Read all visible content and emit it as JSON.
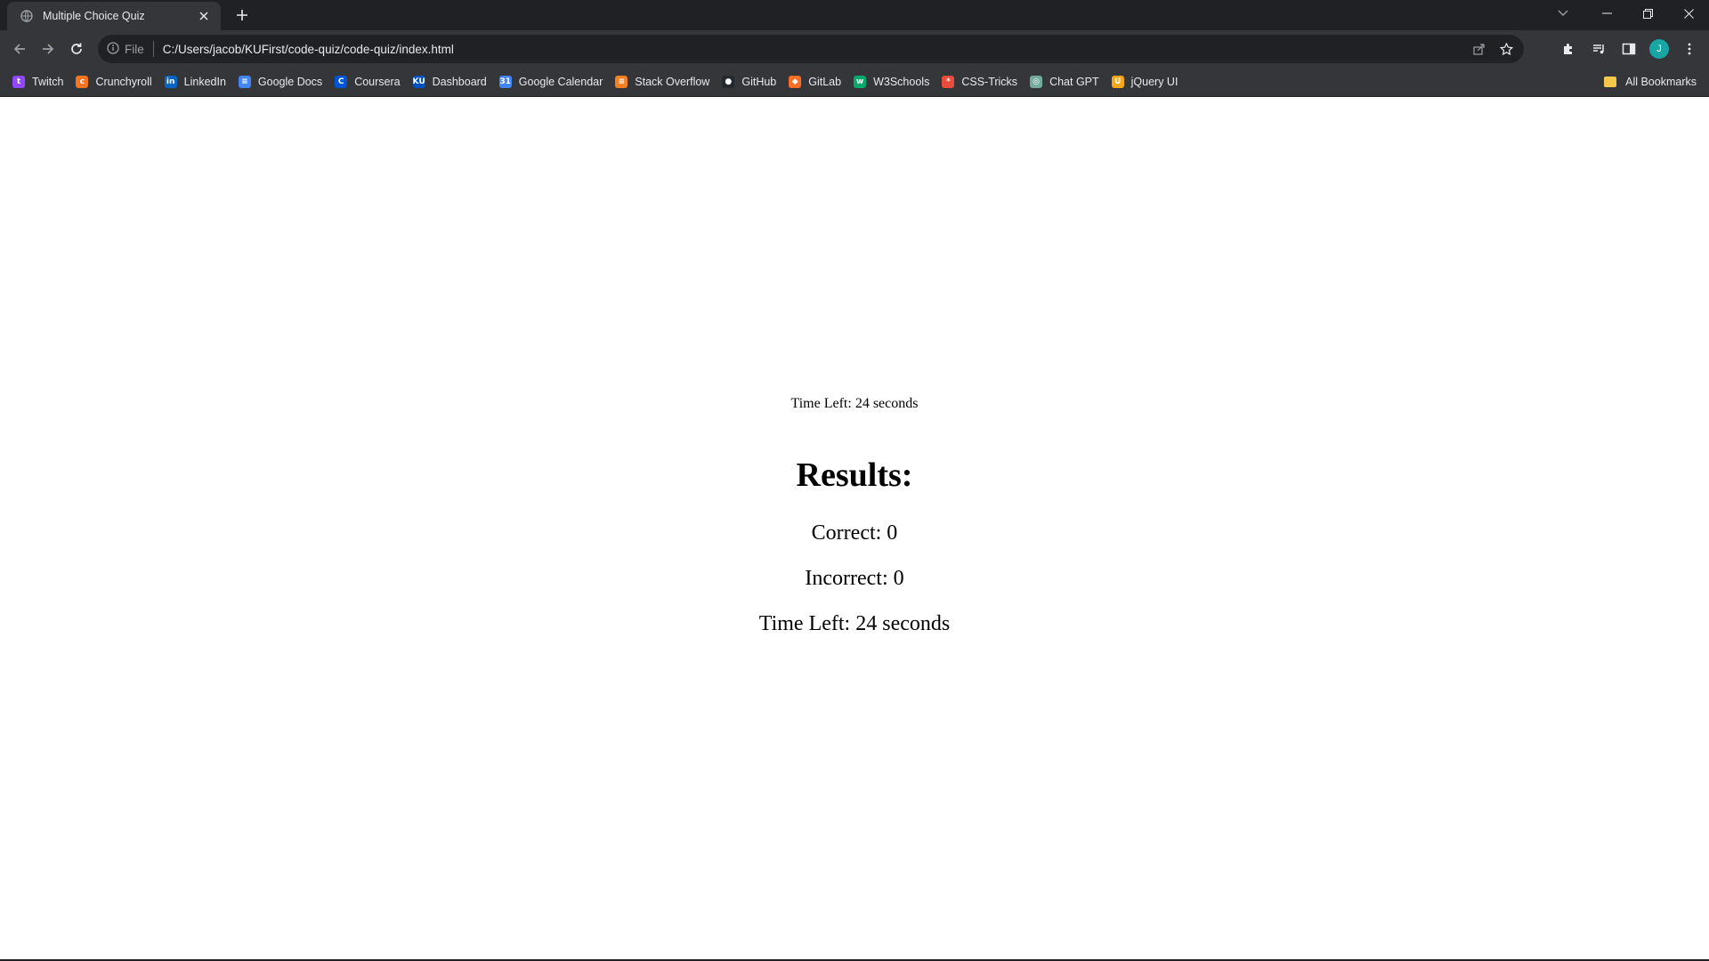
{
  "browser": {
    "tab": {
      "title": "Multiple Choice Quiz"
    },
    "address_bar": {
      "scheme_label": "File",
      "url": "C:/Users/jacob/KUFirst/code-quiz/code-quiz/index.html"
    },
    "profile_initial": "J",
    "bookmarks": [
      {
        "label": "Twitch",
        "icon": "twitch-icon",
        "color": "#9146ff",
        "glyph": "t"
      },
      {
        "label": "Crunchyroll",
        "icon": "crunchyroll-icon",
        "color": "#f47521",
        "glyph": "c"
      },
      {
        "label": "LinkedIn",
        "icon": "linkedin-icon",
        "color": "#0a66c2",
        "glyph": "in"
      },
      {
        "label": "Google Docs",
        "icon": "google-docs-icon",
        "color": "#4285f4",
        "glyph": "≡"
      },
      {
        "label": "Coursera",
        "icon": "coursera-icon",
        "color": "#0056d2",
        "glyph": "C"
      },
      {
        "label": "Dashboard",
        "icon": "ku-icon",
        "color": "#0051ba",
        "glyph": "KU"
      },
      {
        "label": "Google Calendar",
        "icon": "google-calendar-icon",
        "color": "#4285f4",
        "glyph": "31"
      },
      {
        "label": "Stack Overflow",
        "icon": "stack-overflow-icon",
        "color": "#f48024",
        "glyph": "≡"
      },
      {
        "label": "GitHub",
        "icon": "github-icon",
        "color": "#24292f",
        "glyph": "●"
      },
      {
        "label": "GitLab",
        "icon": "gitlab-icon",
        "color": "#fc6d26",
        "glyph": "◆"
      },
      {
        "label": "W3Schools",
        "icon": "w3schools-icon",
        "color": "#04aa6d",
        "glyph": "w"
      },
      {
        "label": "CSS-Tricks",
        "icon": "css-tricks-icon",
        "color": "#e74c3c",
        "glyph": "*"
      },
      {
        "label": "Chat GPT",
        "icon": "chatgpt-icon",
        "color": "#74aa9c",
        "glyph": "◎"
      },
      {
        "label": "jQuery UI",
        "icon": "jquery-ui-icon",
        "color": "#f7a718",
        "glyph": "U"
      }
    ],
    "all_bookmarks_label": "All Bookmarks"
  },
  "quiz": {
    "timer_text": "Time Left: 24 seconds",
    "results_heading": "Results:",
    "correct_text": "Correct: 0",
    "incorrect_text": "Incorrect: 0",
    "time_left_text": "Time Left: 24 seconds"
  }
}
